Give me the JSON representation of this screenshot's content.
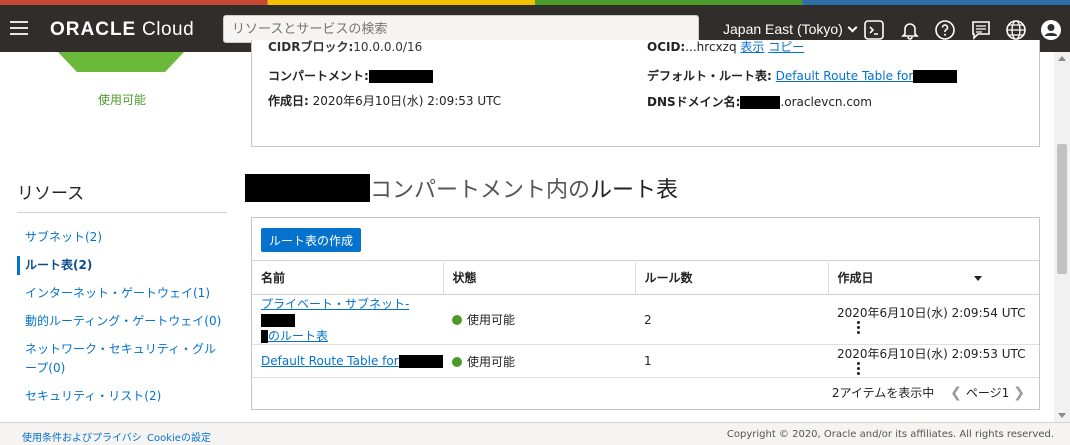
{
  "topbar": {
    "logo_bold": "ORACLE",
    "logo_light": "Cloud",
    "search_placeholder": "リソースとサービスの検索",
    "region": "Japan East (Tokyo)"
  },
  "left": {
    "status": "使用可能",
    "resources_title": "リソース",
    "items": [
      {
        "label": "サブネット(2)"
      },
      {
        "label": "ルート表(2)"
      },
      {
        "label": "インターネット・ゲートウェイ(1)"
      },
      {
        "label": "動的ルーティング・ゲートウェイ(0)"
      },
      {
        "label": "ネットワーク・セキュリティ・グループ(0)"
      },
      {
        "label": "セキュリティ・リスト(2)"
      }
    ]
  },
  "detail": {
    "cidr_label": "CIDRブロック:",
    "cidr_value": "10.0.0.0/16",
    "ocid_label": "OCID:",
    "ocid_value": "...hrcxzq",
    "ocid_show": "表示",
    "ocid_copy": "コピー",
    "compartment_label": "コンパートメント:",
    "created_label": "作成日:",
    "created_value": "2020年6月10日(水) 2:09:53 UTC",
    "default_rt_label": "デフォルト・ルート表:",
    "default_rt_link": "Default Route Table for",
    "dns_label": "DNSドメイン名:",
    "dns_suffix": ".oraclevcn.com"
  },
  "section": {
    "title_part1": "コンパートメント内の",
    "title_part2": "ルート表",
    "create_button": "ルート表の作成",
    "columns": [
      "名前",
      "状態",
      "ルール数",
      "作成日"
    ],
    "rows": [
      {
        "name1": "プライベート・サブネット-",
        "name2": "のルート表",
        "state": "使用可能",
        "rules": "2",
        "created": "2020年6月10日(水) 2:09:54 UTC"
      },
      {
        "name1": "Default Route Table for",
        "state": "使用可能",
        "rules": "1",
        "created": "2020年6月10日(水) 2:09:53 UTC"
      }
    ],
    "showing": "2アイテムを表示中",
    "page": "ページ1"
  },
  "footer": {
    "terms": "使用条件およびプライバシ",
    "cookie": "Cookieの設定",
    "copyright": "Copyright © 2020, Oracle and/or its affiliates. All rights reserved."
  }
}
